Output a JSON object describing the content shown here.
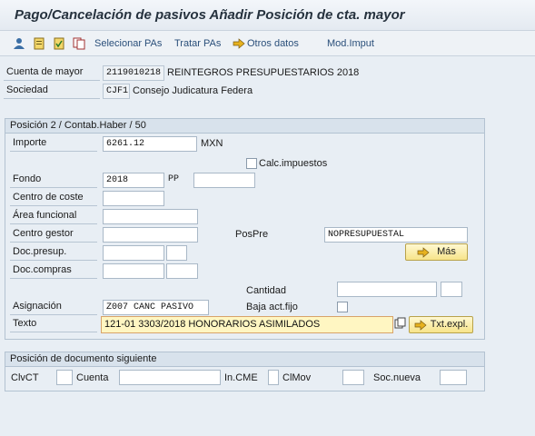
{
  "title": "Pago/Cancelación de pasivos Añadir Posición de cta. mayor",
  "toolbar": {
    "selecionar_pas": "Selecionar PAs",
    "tratar_pas": "Tratar PAs",
    "otros_datos": "Otros datos",
    "mod_imput": "Mod.Imput"
  },
  "header": {
    "cuenta_label": "Cuenta de mayor",
    "cuenta_value": "2119010218",
    "cuenta_desc": "REINTEGROS PRESUPUESTARIOS 2018",
    "sociedad_label": "Sociedad",
    "sociedad_value": "CJF1",
    "sociedad_desc": "Consejo Judicatura Federa"
  },
  "posicion": {
    "heading": "Posición 2 / Contab.Haber / 50",
    "importe_label": "Importe",
    "importe_value": "6261.12",
    "currency": "MXN",
    "calc_impuestos": "Calc.impuestos",
    "fondo_label": "Fondo",
    "fondo_value": "2018",
    "pp_label": "PP",
    "pp_value": "",
    "centro_coste_label": "Centro de coste",
    "area_funcional_label": "Área funcional",
    "centro_gestor_label": "Centro gestor",
    "pospre_label": "PosPre",
    "pospre_value": "NOPRESUPUESTAL",
    "doc_presup_label": "Doc.presup.",
    "mas_button": "Más",
    "doc_compras_label": "Doc.compras",
    "cantidad_label": "Cantidad",
    "asignacion_label": "Asignación",
    "asignacion_value": "Z007 CANC PASIVO",
    "baja_act_fijo": "Baja act.fijo",
    "texto_label": "Texto",
    "texto_value": "121-01 3303/2018 HONORARIOS ASIMILADOS",
    "txt_expl_button": "Txt.expl."
  },
  "siguiente": {
    "heading": "Posición de documento siguiente",
    "clvct_label": "ClvCT",
    "cuenta_label": "Cuenta",
    "incme_label": "In.CME",
    "clmov_label": "ClMov",
    "soc_nueva_label": "Soc.nueva"
  },
  "colors": {
    "accent": "#2a4f7a",
    "yellow_button": "#f7e48a",
    "field_highlight": "#fff6c2"
  }
}
